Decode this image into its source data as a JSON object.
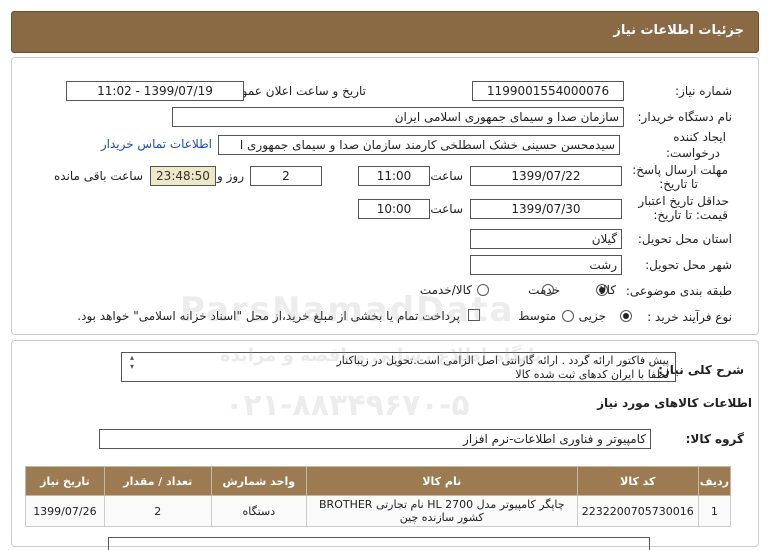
{
  "header": {
    "title": "جزئیات اطلاعات نیاز"
  },
  "form": {
    "need_number_label": "شماره نیاز:",
    "need_number": "1199001554000076",
    "announce_label": "تاریخ و ساعت اعلان عمومی:",
    "announce_value": "1399/07/19 - 11:02",
    "buyer_label": "نام دستگاه خریدار:",
    "buyer_value": "سازمان صدا و سیمای جمهوری اسلامی ایران",
    "creator_label_1": "ایجاد کننده",
    "creator_label_2": "درخواست:",
    "creator_value": "سیدمحسن حسینی خشک اسطلخی کارمند سازمان صدا و سیمای جمهوری ا",
    "contact_link": "اطلاعات تماس خریدار",
    "deadline_label_1": "مهلت ارسال پاسخ:",
    "deadline_label_2": "تا تاریخ:",
    "deadline_date": "1399/07/22",
    "time_label": "ساعت",
    "deadline_time": "11:00",
    "days_value": "2",
    "days_label": "روز و",
    "remaining_time": "23:48:50",
    "remaining_label": "ساعت باقی مانده",
    "validity_label_1": "حداقل تاریخ اعتبار",
    "validity_label_2": "قیمت: تا تاریخ:",
    "validity_date": "1399/07/30",
    "validity_time_label": "ساعت",
    "validity_time": "10:00",
    "province_label": "استان محل تحویل:",
    "province_value": "گیلان",
    "city_label": "شهر محل تحویل:",
    "city_value": "رشت",
    "category_label": "طبقه بندی موضوعی:",
    "category_options": [
      "کالا",
      "خدمت",
      "کالا/خدمت"
    ],
    "process_label": "نوع فرآیند خرید :",
    "process_options": [
      "جزیی",
      "متوسط"
    ],
    "payment_note": "پرداخت تمام یا بخشی از مبلغ خرید،از محل \"اسناد خزانه اسلامی\" خواهد بود."
  },
  "details": {
    "desc_label": "شرح کلی نیاز:",
    "desc_line1": "پیش فاکتور ارائه گردد . ارائه گارانتی اصل الزامی است.تحویل در زیباکنار",
    "desc_line2": "لطفا با ایران کدهای ثبت شده کالا",
    "goods_info_label": "اطلاعات کالاهای مورد نیاز",
    "group_label": "گروه کالا:",
    "group_value": "کامپیوتر و فناوری اطلاعات-نرم افزار"
  },
  "table": {
    "headers": [
      "ردیف",
      "کد کالا",
      "نام کالا",
      "واحد شمارش",
      "تعداد / مقدار",
      "تاریخ نیاز"
    ],
    "rows": [
      [
        "1",
        "2232200705730016",
        "چاپگر کامپیوتر مدل HL 2700 نام تجارتی BROTHER کشور سازنده چین",
        "دستگاه",
        "2",
        "1399/07/26"
      ]
    ]
  },
  "watermark": {
    "line1": "ParsNamadData",
    "line2": "پایگاه اطلاع رسانی مناقصه و مزایده",
    "line3": "۰۲۱-۸۸۳۴۹۶۷۰-۵"
  }
}
